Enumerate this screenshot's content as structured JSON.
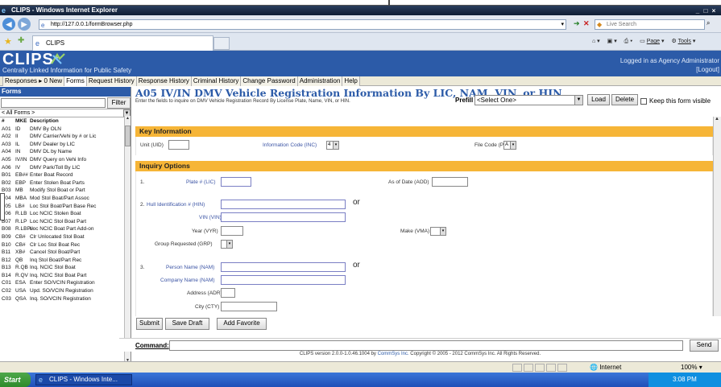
{
  "window": {
    "title": "CLIPS - Windows Internet Explorer",
    "controls": [
      "_",
      "□",
      "×"
    ]
  },
  "address_bar": {
    "url": "http://127.0.0.1/formBrowser.php",
    "search_placeholder": "Live Search"
  },
  "browser_tab": {
    "label": "CLIPS"
  },
  "browser_commands": {
    "page": "Page",
    "tools": "Tools"
  },
  "app": {
    "logo": "CLIPS",
    "trademark": "™",
    "tagline": "Centrally Linked Information for Public Safety",
    "logged_in": "Logged in as Agency Administrator",
    "logout": "[Logout]",
    "menu": [
      "Responses ▸ 0 New",
      "Forms",
      "Request History",
      "Response History",
      "Criminal History",
      "Change Password",
      "Administration",
      "Help"
    ]
  },
  "forms_panel": {
    "heading": "Forms",
    "filter_button": "Filter",
    "category": "< All Forms >",
    "columns": [
      "#",
      "MKE",
      "Description"
    ],
    "rows": [
      [
        "A01",
        "ID",
        "DMV By OLN"
      ],
      [
        "A02",
        "II",
        "DMV Carrier/Vehi by # or Lic"
      ],
      [
        "A03",
        "IL",
        "DMV Dealer by LIC"
      ],
      [
        "A04",
        "IN",
        "DMV DL by Name"
      ],
      [
        "A05",
        "IV/IN",
        "DMV Query on Vehi Info"
      ],
      [
        "A06",
        "IV",
        "DMV Park/Toll By LIC"
      ],
      [
        "B01",
        "EB##",
        "Enter Boat Record"
      ],
      [
        "B02",
        "EBP",
        "Enter Stolen Boat Parts"
      ],
      [
        "B03",
        "MB",
        "Modify Stol Boat or Part"
      ],
      [
        "B04",
        "MBA",
        "Mod Stol Boat/Part Assoc"
      ],
      [
        "B05",
        "LB#",
        "Loc Stol Boat/Part Base Rec"
      ],
      [
        "B06",
        "R.LB",
        "Loc NCIC Stolen Boat"
      ],
      [
        "B07",
        "R.LP",
        "Loc NCIC Stol Boat Part"
      ],
      [
        "B08",
        "R.LBP#",
        "Loc NCIC Boat Part Add-on"
      ],
      [
        "B09",
        "CB#",
        "Clr Unlocated Stol Boat"
      ],
      [
        "B10",
        "CB#",
        "Clr Loc Stol Boat Rec"
      ],
      [
        "B11",
        "XB#",
        "Cancel Stol Boat/Part"
      ],
      [
        "B12",
        "QB",
        "Inq Stol Boat/Part Rec"
      ],
      [
        "B13",
        "R.QB",
        "Inq. NCIC Stol Boat"
      ],
      [
        "B14",
        "R.QV",
        "Inq. NCIC Stol Boat Part"
      ],
      [
        "C01",
        "ESA",
        "Enter SO/VCIN Registration"
      ],
      [
        "C02",
        "USA",
        "Upd. SO/VCIN Registration"
      ],
      [
        "C03",
        "QSA",
        "Inq. SO/VCIN Registration"
      ]
    ]
  },
  "form": {
    "title": "A05 IV/IN DMV Vehicle Registration Information By LIC, NAM, VIN, or HIN",
    "subtitle": "Enter the fields to inquire on DMV Vehicle Registration Record By License Plate, Name, VIN, or HIN.",
    "prefill_label": "Prefill",
    "prefill_value": "<Select One>",
    "load_button": "Load",
    "delete_button": "Delete",
    "keep_visible": "Keep this form visible",
    "key_info": {
      "heading": "Key Information",
      "unit_label": "Unit (UID)",
      "inc_label": "Information Code (INC)",
      "inc_value": "4",
      "plc_label": "File Code (PLC)",
      "plc_value": "A"
    },
    "inquiry": {
      "heading": "Inquiry Options",
      "n1": "1.",
      "plate_label": "Plate # (LIC)",
      "aod_label": "As of Date (AOD)",
      "n2": "2.",
      "hin_label": "Hull Identification # (HIN)",
      "or1": "or",
      "vin_label": "VIN (VIN)",
      "year_label": "Year (VYR)",
      "make_label": "Make (VMA)",
      "grp_label": "Group Requested (GRP)",
      "n3": "3.",
      "nam_label": "Person Name (NAM)",
      "or2": "or",
      "company_label": "Company Name (NAM)",
      "adr_label": "Address (ADR)",
      "cty_label": "City (CTY)"
    },
    "submit_button": "Submit",
    "save_draft_button": "Save Draft",
    "add_favorite_button": "Add Favorite"
  },
  "command": {
    "label": "Command:",
    "send_button": "Send"
  },
  "footer": {
    "version_prefix": "CLIPS version 2.0.0-1.0.46.1004 by",
    "company": "CommSys Inc.",
    "version_suffix": "Copyright © 2005 - 2012 CommSys Inc. All Rights Reserved."
  },
  "statusbar": {
    "zone": "Internet",
    "zoom": "100%"
  },
  "taskbar": {
    "start": "Start",
    "task": "CLIPS - Windows Inte...",
    "time": "3:08 PM"
  },
  "colors": {
    "app_blue": "#2c5ba8",
    "section_orange": "#f6b537",
    "title_blue": "#2c5ba8"
  }
}
